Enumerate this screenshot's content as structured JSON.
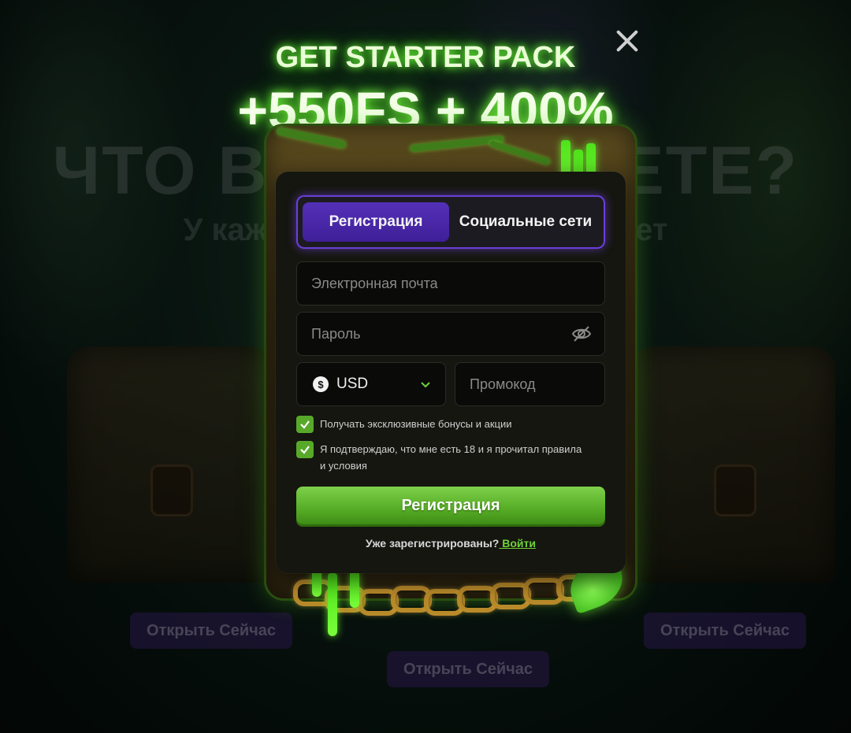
{
  "background": {
    "title": "ЧТО ВЫ ВЫБЕРЕТЕ?",
    "subtitle": "У каждого сундука свой секрет",
    "open_buttons": [
      "Открыть Сейчас",
      "Открыть Сейчас",
      "Открыть Сейчас"
    ]
  },
  "promo": {
    "line1": "GET STARTER PACK",
    "line2": "+550FS + 400%"
  },
  "tabs": [
    {
      "label": "Регистрация",
      "active": true
    },
    {
      "label": "Социальные сети",
      "active": false
    }
  ],
  "form": {
    "email_placeholder": "Электронная почта",
    "password_placeholder": "Пароль",
    "currency": "USD",
    "currency_icon": "dollar-coin-icon",
    "promo_placeholder": "Промокод",
    "checkbox_bonuses": "Получать эксклюзивные бонусы и акции",
    "checkbox_bonuses_checked": true,
    "checkbox_age": "Я подтверждаю, что мне есть 18 и я прочитал правила и условия",
    "checkbox_age_checked": true,
    "submit_label": "Регистрация",
    "login_prompt": "Уже зарегистрированы?",
    "login_link": " Войти"
  },
  "colors": {
    "accent_purple": "#5430b8",
    "accent_green": "#56ad25",
    "glow_green": "#6cff3a"
  }
}
